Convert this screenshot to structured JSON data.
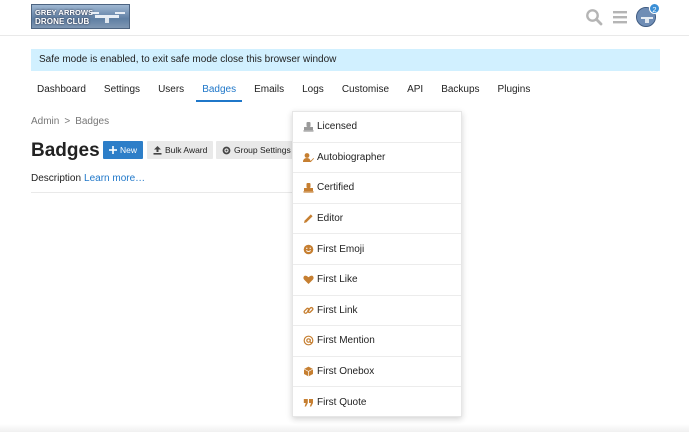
{
  "header": {
    "logo_line1": "GREY ARROWS",
    "logo_line2": "DRONE CLUB",
    "notification_count": "2"
  },
  "banner": {
    "text": "Safe mode is enabled, to exit safe mode close this browser window"
  },
  "nav": {
    "tabs": [
      {
        "label": "Dashboard",
        "active": false
      },
      {
        "label": "Settings",
        "active": false
      },
      {
        "label": "Users",
        "active": false
      },
      {
        "label": "Badges",
        "active": true
      },
      {
        "label": "Emails",
        "active": false
      },
      {
        "label": "Logs",
        "active": false
      },
      {
        "label": "Customise",
        "active": false
      },
      {
        "label": "API",
        "active": false
      },
      {
        "label": "Backups",
        "active": false
      },
      {
        "label": "Plugins",
        "active": false
      }
    ]
  },
  "breadcrumb": {
    "root": "Admin",
    "separator": ">",
    "current": "Badges"
  },
  "page": {
    "title": "Badges",
    "new_label": "New",
    "bulk_award_label": "Bulk Award",
    "group_settings_label": "Group Settings",
    "description_label": "Description",
    "learn_more": "Learn more…"
  },
  "dropdown": {
    "items": [
      {
        "label": "Licensed",
        "icon": "certificate-icon"
      },
      {
        "label": "Autobiographer",
        "icon": "user-edit-icon"
      },
      {
        "label": "Certified",
        "icon": "certificate-icon"
      },
      {
        "label": "Editor",
        "icon": "pencil-icon"
      },
      {
        "label": "First Emoji",
        "icon": "smile-icon"
      },
      {
        "label": "First Like",
        "icon": "heart-icon"
      },
      {
        "label": "First Link",
        "icon": "link-icon"
      },
      {
        "label": "First Mention",
        "icon": "at-icon"
      },
      {
        "label": "First Onebox",
        "icon": "cube-icon"
      },
      {
        "label": "First Quote",
        "icon": "quote-icon"
      }
    ]
  },
  "colors": {
    "accent": "#1f77c9",
    "banner_bg": "#d1f0ff",
    "badge_bronze": "#c67f31",
    "badge_gray": "#9a9a9a"
  }
}
